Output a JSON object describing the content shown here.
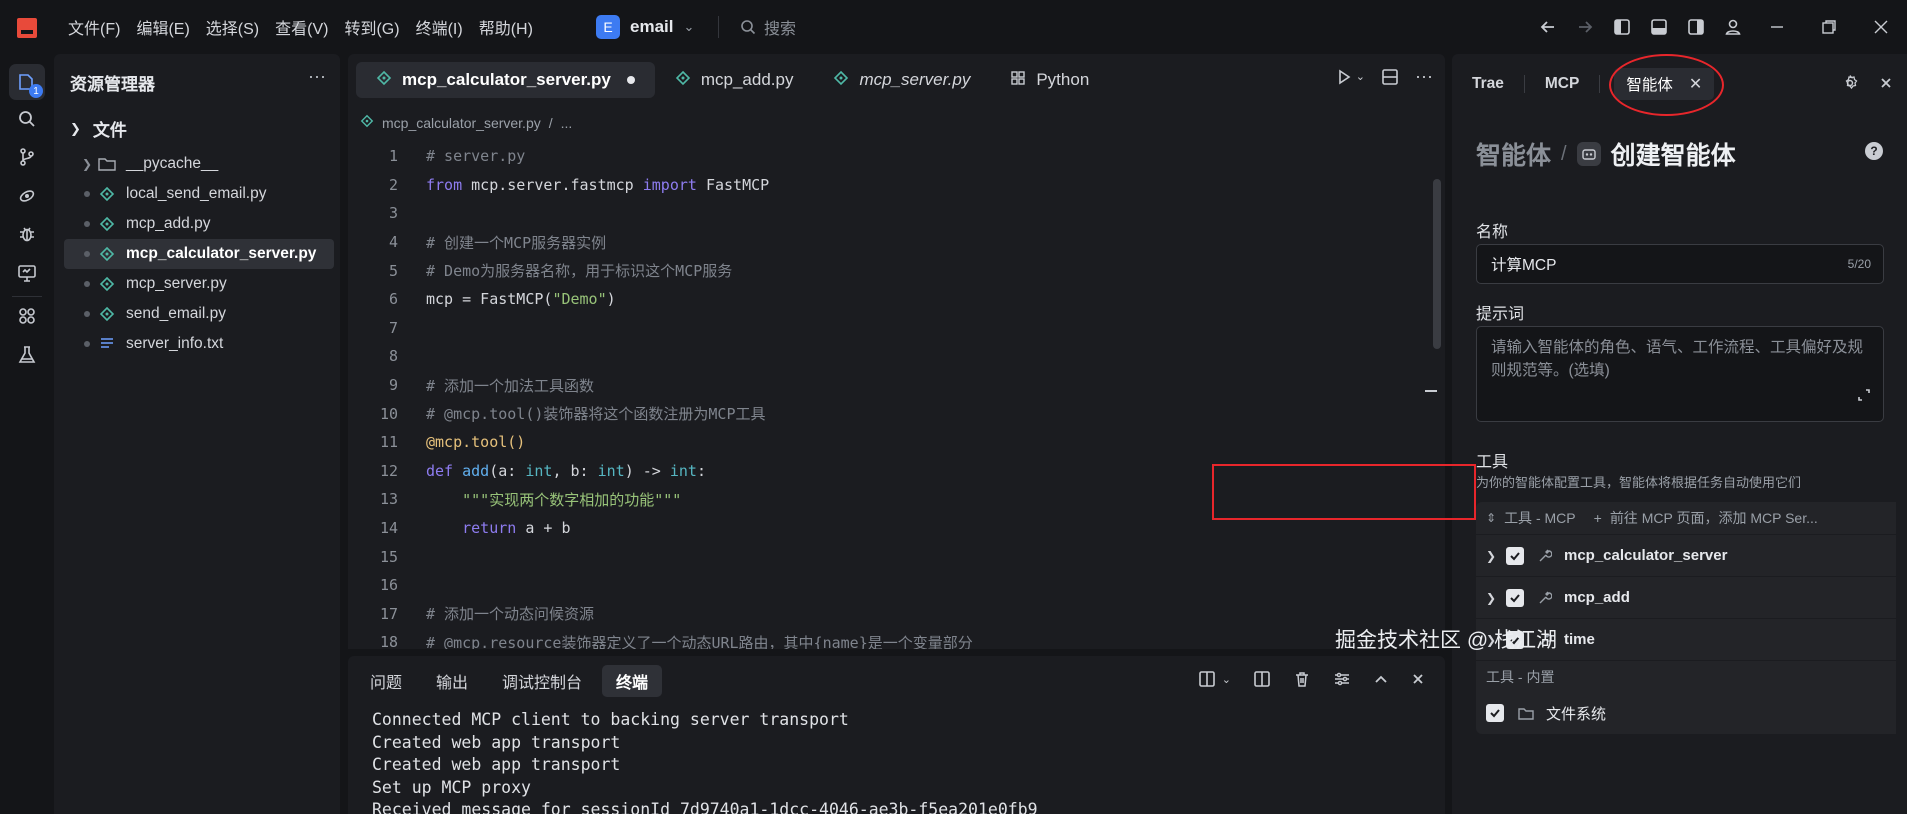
{
  "menu": [
    "文件(F)",
    "编辑(E)",
    "选择(S)",
    "查看(V)",
    "转到(G)",
    "终端(I)",
    "帮助(H)"
  ],
  "project": {
    "badge": "E",
    "name": "email"
  },
  "search": {
    "placeholder": "搜索"
  },
  "explorer": {
    "title": "资源管理器",
    "root": "文件",
    "items": [
      {
        "name": "__pycache__",
        "type": "folder"
      },
      {
        "name": "local_send_email.py",
        "type": "py"
      },
      {
        "name": "mcp_add.py",
        "type": "py"
      },
      {
        "name": "mcp_calculator_server.py",
        "type": "py",
        "selected": true
      },
      {
        "name": "mcp_server.py",
        "type": "py"
      },
      {
        "name": "send_email.py",
        "type": "py"
      },
      {
        "name": "server_info.txt",
        "type": "txt"
      }
    ]
  },
  "editor": {
    "tabs": [
      {
        "label": "mcp_calculator_server.py",
        "active": true,
        "modified": true
      },
      {
        "label": "mcp_add.py"
      },
      {
        "label": "mcp_server.py",
        "italic": true
      },
      {
        "label": "Python"
      }
    ],
    "breadcrumb": [
      "mcp_calculator_server.py",
      "/",
      "..."
    ],
    "line_numbers": [
      "1",
      "2",
      "3",
      "4",
      "5",
      "6",
      "7",
      "8",
      "9",
      "10",
      "11",
      "12",
      "13",
      "14",
      "15",
      "16",
      "17",
      "18"
    ]
  },
  "panel": {
    "tabs": [
      "问题",
      "输出",
      "调试控制台",
      "终端"
    ],
    "active_tab": "终端",
    "terminal_lines": [
      "Connected MCP client to backing server transport",
      "Created web app transport",
      "Created web app transport",
      "Set up MCP proxy",
      "Received message for sessionId 7d9740a1-1dcc-4046-ae3b-f5ea201e0fb9"
    ]
  },
  "right": {
    "tabs": [
      "Trae",
      "MCP",
      "智能体"
    ],
    "breadcrumb_parent": "智能体",
    "breadcrumb_current": "创建智能体",
    "name_label": "名称",
    "name_value": "计算MCP",
    "name_count": "5/20",
    "prompt_label": "提示词",
    "prompt_placeholder": "请输入智能体的角色、语气、工作流程、工具偏好及规则规范等。(选填)",
    "tools_label": "工具",
    "tools_desc": "为你的智能体配置工具，智能体将根据任务自动使用它们",
    "mcp_group_header": "工具 - MCP",
    "mcp_group_action": "前往 MCP 页面，添加 MCP Ser...",
    "mcp_tools": [
      "mcp_calculator_server",
      "mcp_add",
      "time"
    ],
    "builtin_header": "工具 - 内置",
    "builtin_tools": [
      "文件系统"
    ]
  },
  "watermark": "掘金技术社区 @ 栈江湖",
  "colors": {
    "accent": "#3d7bf2",
    "annotation_red": "#e8262b",
    "logo": "#e84a3a"
  }
}
